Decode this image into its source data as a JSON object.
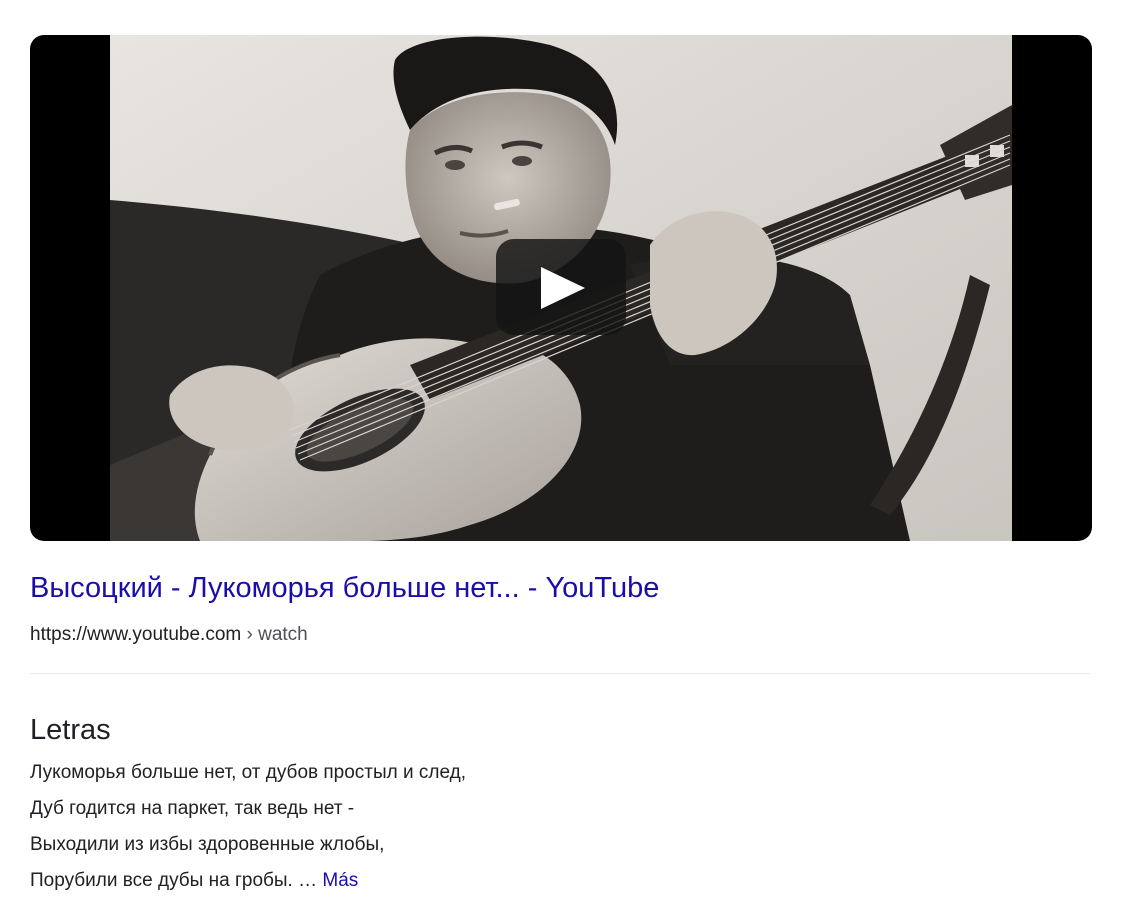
{
  "video": {
    "thumbnail_icon": "video-thumbnail-bw-guitarist",
    "play_icon": "play-icon"
  },
  "result": {
    "title": "Высоцкий - Лукоморья больше нет... - YouTube",
    "url_domain": "https://www.youtube.com",
    "url_path": " › watch"
  },
  "lyrics": {
    "heading": "Letras",
    "lines": [
      "Лукоморья больше нет, от дубов простыл и след,",
      "Дуб годится на паркет, так ведь нет -",
      "Выходили из избы здоровенные жлобы,",
      "Порубили все дубы на гробы. … "
    ],
    "more_label": "Más"
  },
  "colors": {
    "link": "#1a0dab",
    "text": "#202124",
    "secondary": "#4d5156"
  }
}
